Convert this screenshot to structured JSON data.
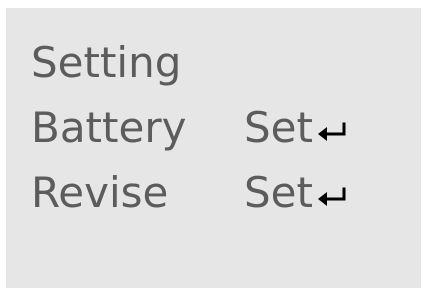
{
  "menu": {
    "title": "Setting",
    "items": [
      {
        "label": "Battery",
        "action_label": "Set",
        "action_icon": "enter-icon"
      },
      {
        "label": "Revise",
        "action_label": "Set",
        "action_icon": "enter-icon"
      }
    ]
  },
  "colors": {
    "screen_background": "#e6e6e7",
    "text": "#5c5c5c",
    "icon": "#000000"
  }
}
